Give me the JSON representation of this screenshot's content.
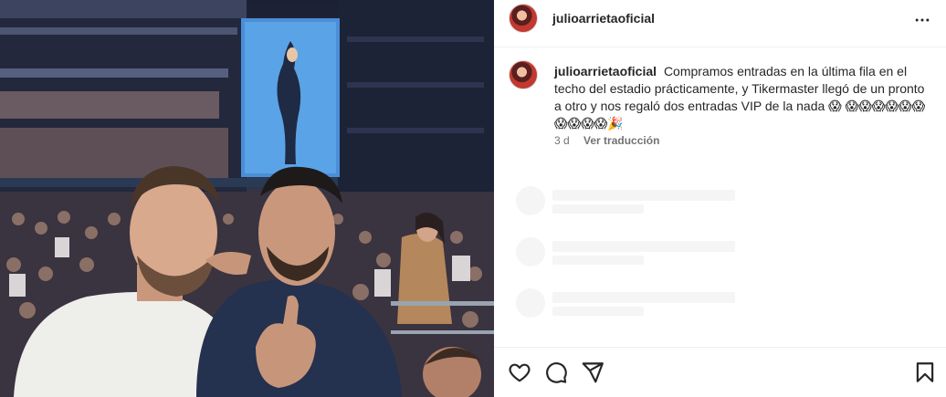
{
  "post": {
    "username": "julioarrietaoficial",
    "caption_text": "Compramos entradas en la última fila en el techo del estadio prácticamente, y Tikermaster llegó de un pronto a otro y nos regaló dos entradas VIP de la nada 😱 😱😱😱😱😱😱😱😱😱😱🎉",
    "age": "3 d",
    "translate_label": "Ver traducción"
  },
  "icons": {
    "more": "more-horizontal-icon",
    "like": "heart-icon",
    "comment": "comment-icon",
    "share": "send-icon",
    "save": "bookmark-icon"
  },
  "colors": {
    "text": "#262626",
    "secondary": "#737373",
    "divider": "#efefef",
    "skeleton": "#f5f5f5"
  }
}
